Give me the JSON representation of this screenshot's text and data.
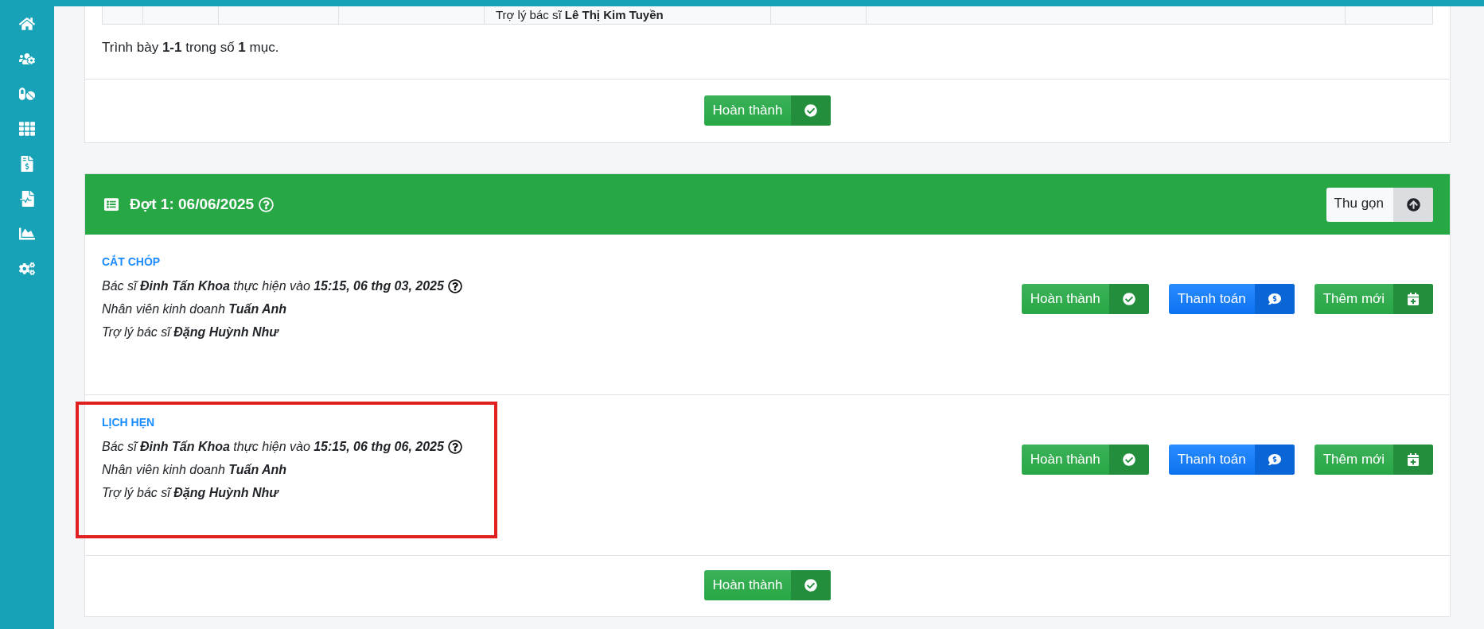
{
  "previous_card": {
    "table_cell": "Trợ lý bác sĩ **Lê Thị Kim Tuyền**",
    "summary": "Trình bày **1-1** trong số **1** mục.",
    "footer_button": {
      "label": "Hoàn thành"
    }
  },
  "section": {
    "title": "Đợt 1: 06/06/2025",
    "collapse_button": {
      "label": "Thu gọn"
    },
    "procedures": [
      {
        "name": "CẮT CHÓP",
        "highlighted": false,
        "lines": [
          {
            "text": "Bác sĩ **Đinh Tấn Khoa** thực hiện vào **15:15, 06 thg 03, 2025**",
            "help": true
          },
          {
            "text": "Nhân viên kinh doanh **Tuấn Anh**",
            "help": false
          },
          {
            "text": "Trợ lý bác sĩ **Đặng Huỳnh Như**",
            "help": false
          }
        ],
        "actions": [
          {
            "label": "Hoàn thành",
            "kind": "complete"
          },
          {
            "label": "Thanh toán",
            "kind": "payment"
          },
          {
            "label": "Thêm mới",
            "kind": "add"
          }
        ]
      },
      {
        "name": "LỊCH HẸN",
        "highlighted": true,
        "lines": [
          {
            "text": "Bác sĩ **Đinh Tấn Khoa** thực hiện vào **15:15, 06 thg 06, 2025**",
            "help": true
          },
          {
            "text": "Nhân viên kinh doanh **Tuấn Anh**",
            "help": false
          },
          {
            "text": "Trợ lý bác sĩ **Đặng Huỳnh Như**",
            "help": false
          }
        ],
        "actions": [
          {
            "label": "Hoàn thành",
            "kind": "complete"
          },
          {
            "label": "Thanh toán",
            "kind": "payment"
          },
          {
            "label": "Thêm mới",
            "kind": "add"
          }
        ]
      }
    ],
    "footer_button": {
      "label": "Hoàn thành"
    }
  }
}
